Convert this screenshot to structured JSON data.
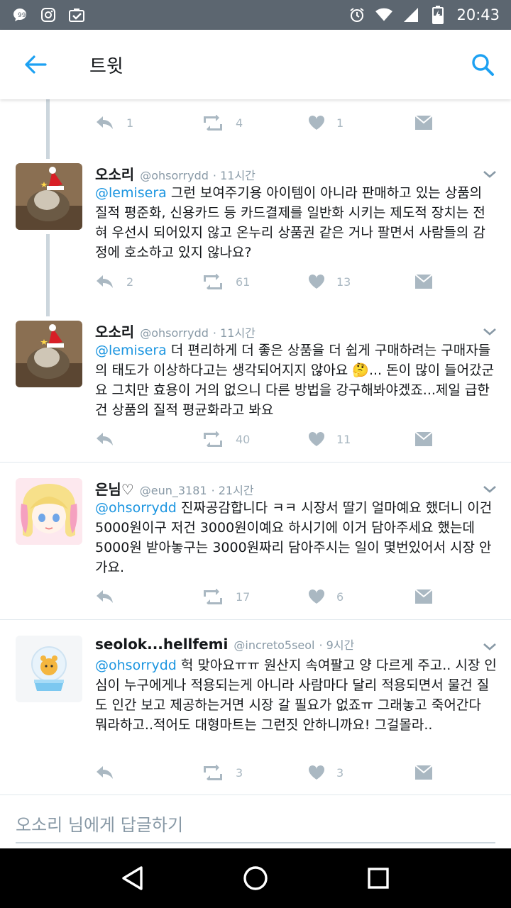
{
  "status_bar": {
    "time": "20:43",
    "left_icons": [
      "chat-bubble-icon",
      "instagram-icon",
      "clipboard-check-icon"
    ],
    "right_icons": [
      "alarm-icon",
      "wifi-icon",
      "cell-signal-icon",
      "battery-charging-icon"
    ]
  },
  "header": {
    "title": "트윗",
    "back_icon": "arrow-left-icon",
    "search_icon": "search-icon",
    "accent": "#1da1f2"
  },
  "top_actions": {
    "reply": "1",
    "retweet": "4",
    "like": "1"
  },
  "tweets": [
    {
      "name": "오소리",
      "handle": "@ohsorrydd",
      "time": "· 11시간",
      "mention": "@lemisera",
      "text": " 그런 보여주기용 아이템이 아니라 판매하고 있는 상품의 질적 평준화, 신용카드 등 카드결제를 일반화 시키는 제도적 장치는 전혀 우선시 되어있지 않고 온누리 상품권 같은 거나 팔면서 사람들의 감정에 호소하고 있지 않나요?",
      "reply": "2",
      "retweet": "61",
      "like": "13"
    },
    {
      "name": "오소리",
      "handle": "@ohsorrydd",
      "time": "· 11시간",
      "mention": "@lemisera",
      "text": " 더 편리하게 더 좋은 상품을 더 쉽게 구매하려는 구매자들의 태도가 이상하다고는 생각되어지지 않아요 🤔... 돈이 많이 들어갔군요 그치만 효용이 거의 없으니 다른 방법을 강구해봐야겠죠...제일 급한 건 상품의 질적 평균화라고 봐요",
      "reply": "",
      "retweet": "40",
      "like": "11"
    },
    {
      "name": "은님♡",
      "handle": "@eun_3181",
      "time": "· 21시간",
      "mention": "@ohsorrydd",
      "text": " 진짜공감합니다 ㅋㅋ 시장서 딸기 얼마예요 했더니 이건 5000원이구 저건 3000원이예요 하시기에 이거 담아주세요 했는데 5000원 받아놓구는 3000원짜리 담아주시는 일이 몇번있어서 시장 안가요.",
      "reply": "",
      "retweet": "17",
      "like": "6"
    },
    {
      "name": "seolok...hellfemi",
      "handle": "@increto5seol",
      "time": "· 9시간",
      "mention": "@ohsorrydd",
      "text": " 헉 맞아요ㅠㅠ 원산지 속여팔고 양 다르게 주고.. 시장 인심이 누구에게나 적용되는게 아니라 사람마다 달리 적용되면서 물건 질도 인간 보고 제공하는거면 시장 갈 필요가 없죠ㅠ 그래놓고 죽어간다 뭐라하고..적어도 대형마트는 그런짓 안하니까요! 그걸몰라..",
      "reply": "",
      "retweet": "3",
      "like": "3"
    }
  ],
  "reply_bar": {
    "placeholder": "오소리 님에게 답글하기"
  },
  "nav": {
    "icons": [
      "back-triangle-icon",
      "home-circle-icon",
      "recents-square-icon"
    ]
  }
}
